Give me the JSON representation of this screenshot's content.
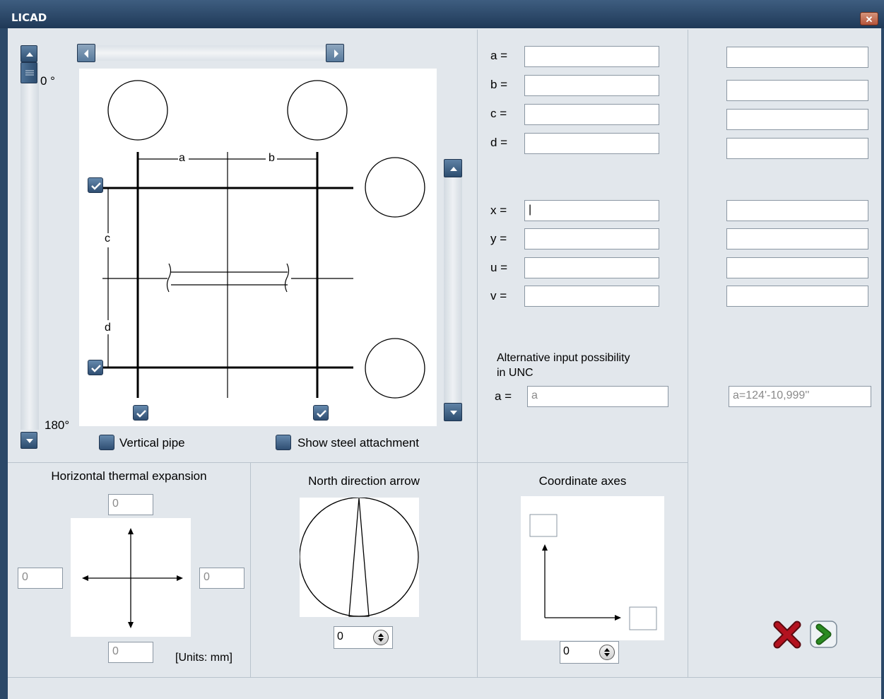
{
  "window": {
    "title": "LICAD",
    "close_glyph": "✕"
  },
  "angle_slider": {
    "top_label": "0 °",
    "bottom_label": "180°"
  },
  "drawing": {
    "dim_a": "a",
    "dim_b": "b",
    "dim_c": "c",
    "dim_d": "d"
  },
  "checkboxes": {
    "vertical_pipe": "Vertical pipe",
    "show_steel": "Show steel attachment"
  },
  "fields": {
    "a_label": "a =",
    "b_label": "b =",
    "c_label": "c =",
    "d_label": "d =",
    "x_label": "x =",
    "y_label": "y =",
    "u_label": "u =",
    "v_label": "v =",
    "a_value": "",
    "b_value": "",
    "c_value": "",
    "d_value": "",
    "x_value": "|",
    "y_value": "",
    "u_value": "",
    "v_value": ""
  },
  "alt_input": {
    "heading_line1": "Alternative input possibility",
    "heading_line2": "in UNC",
    "a_label": "a =",
    "a_value": "a",
    "unc_value": "a=124'-10,999''"
  },
  "thermal": {
    "title": "Horizontal thermal expansion",
    "top": "0",
    "left": "0",
    "right": "0",
    "bottom": "0",
    "units": "[Units: mm]"
  },
  "north": {
    "title": "North direction arrow",
    "value": "0"
  },
  "coords": {
    "title": "Coordinate axes",
    "value": "0"
  },
  "icons": {
    "cancel": "cancel-x-icon",
    "ok": "ok-arrow-icon"
  },
  "colors": {
    "titlebar": "#2b4868",
    "panel": "#e2e7ec",
    "cancel": "#b3121f",
    "ok": "#2b8a22"
  }
}
